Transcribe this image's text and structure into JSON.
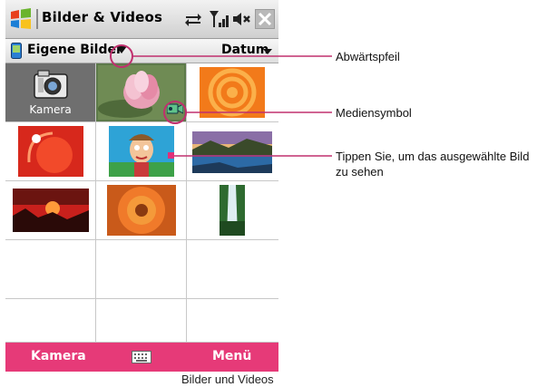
{
  "titlebar": {
    "app_title": "Bilder & Videos",
    "icons": [
      "windows-start-icon",
      "sync-icon",
      "signal-icon",
      "volume-muted-icon",
      "close-icon"
    ]
  },
  "toolbar": {
    "folder_label": "Eigene Bilder",
    "sort_label": "Datum"
  },
  "grid": {
    "camera_label": "Kamera",
    "thumbnails": [
      "camera",
      "lotus-flower-video",
      "orange-circles",
      "red-swirl",
      "cartoon-man",
      "lake-landscape",
      "red-sunset",
      "orange-flower",
      "waterfall"
    ]
  },
  "softkeys": {
    "left": "Kamera",
    "right": "Menü"
  },
  "callouts": {
    "arrow": "Abwärtspfeil",
    "media": "Mediensymbol",
    "tap_line1": "Tippen Sie, um das ausgewählte Bild",
    "tap_line2": "zu sehen"
  },
  "caption": "Bilder und Videos",
  "colors": {
    "accent": "#e63a78",
    "callout_ring": "#c0306e",
    "grid_lines": "#c8c8c8"
  }
}
